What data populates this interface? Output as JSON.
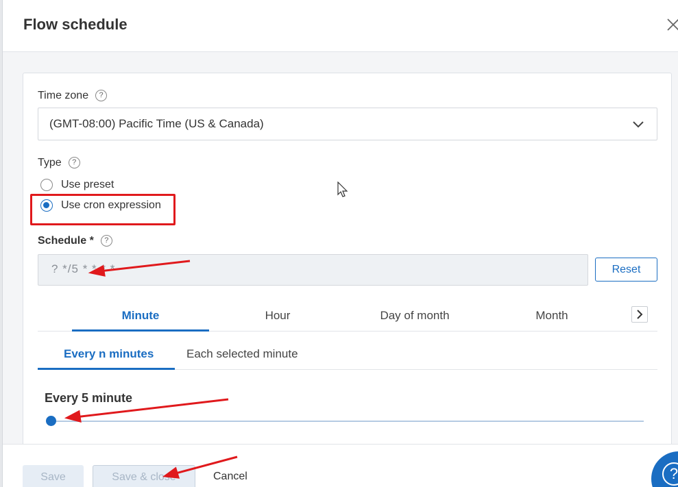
{
  "dialog": {
    "title": "Flow schedule",
    "close_icon": "close-icon"
  },
  "timezone": {
    "label": "Time zone",
    "help": "?",
    "value": "(GMT-08:00) Pacific Time (US & Canada)"
  },
  "type": {
    "label": "Type",
    "help": "?",
    "options": [
      {
        "label": "Use preset",
        "selected": false
      },
      {
        "label": "Use cron expression",
        "selected": true
      }
    ]
  },
  "schedule": {
    "label": "Schedule *",
    "help": "?",
    "value": "? */5 * * * *",
    "reset_label": "Reset"
  },
  "tabs": {
    "items": [
      "Minute",
      "Hour",
      "Day of month",
      "Month"
    ],
    "active": "Minute"
  },
  "subtabs": {
    "items": [
      "Every n minutes",
      "Each selected minute"
    ],
    "active": "Every n minutes"
  },
  "slider": {
    "label": "Every 5 minute",
    "value": 5
  },
  "footer": {
    "save_label": "Save",
    "save_close_label": "Save & close",
    "cancel_label": "Cancel"
  },
  "help_fab": {
    "label": "?"
  },
  "colors": {
    "accent": "#1a6dc2",
    "annotation": "#e0191c"
  }
}
